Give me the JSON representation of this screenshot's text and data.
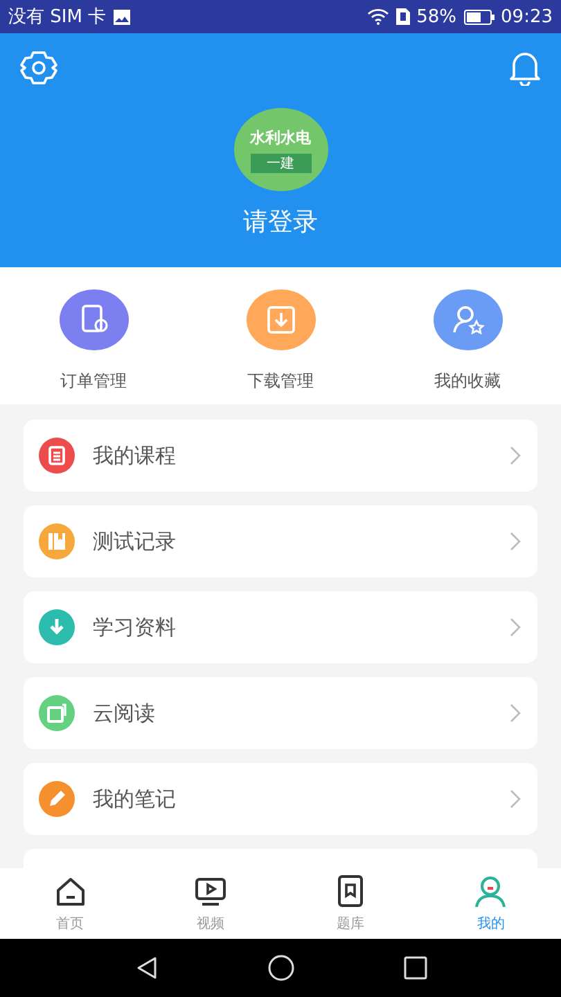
{
  "status_bar": {
    "carrier": "没有 SIM 卡",
    "battery": "58%",
    "time": "09:23"
  },
  "header": {
    "avatar": {
      "title": "水利水电",
      "subtitle": "一建"
    },
    "login": "请登录"
  },
  "quick_actions": [
    {
      "label": "订单管理",
      "color": "#7b7ff0"
    },
    {
      "label": "下载管理",
      "color": "#ffa85a"
    },
    {
      "label": "我的收藏",
      "color": "#6a9cf5"
    }
  ],
  "menu": [
    {
      "label": "我的课程",
      "color": "#ec4c4c"
    },
    {
      "label": "测试记录",
      "color": "#f6a93a"
    },
    {
      "label": "学习资料",
      "color": "#2bbcae"
    },
    {
      "label": "云阅读",
      "color": "#63d17f"
    },
    {
      "label": "我的笔记",
      "color": "#f6902e"
    }
  ],
  "tabs": [
    {
      "label": "首页",
      "selected": false
    },
    {
      "label": "视频",
      "selected": false
    },
    {
      "label": "题库",
      "selected": false
    },
    {
      "label": "我的",
      "selected": true
    }
  ]
}
